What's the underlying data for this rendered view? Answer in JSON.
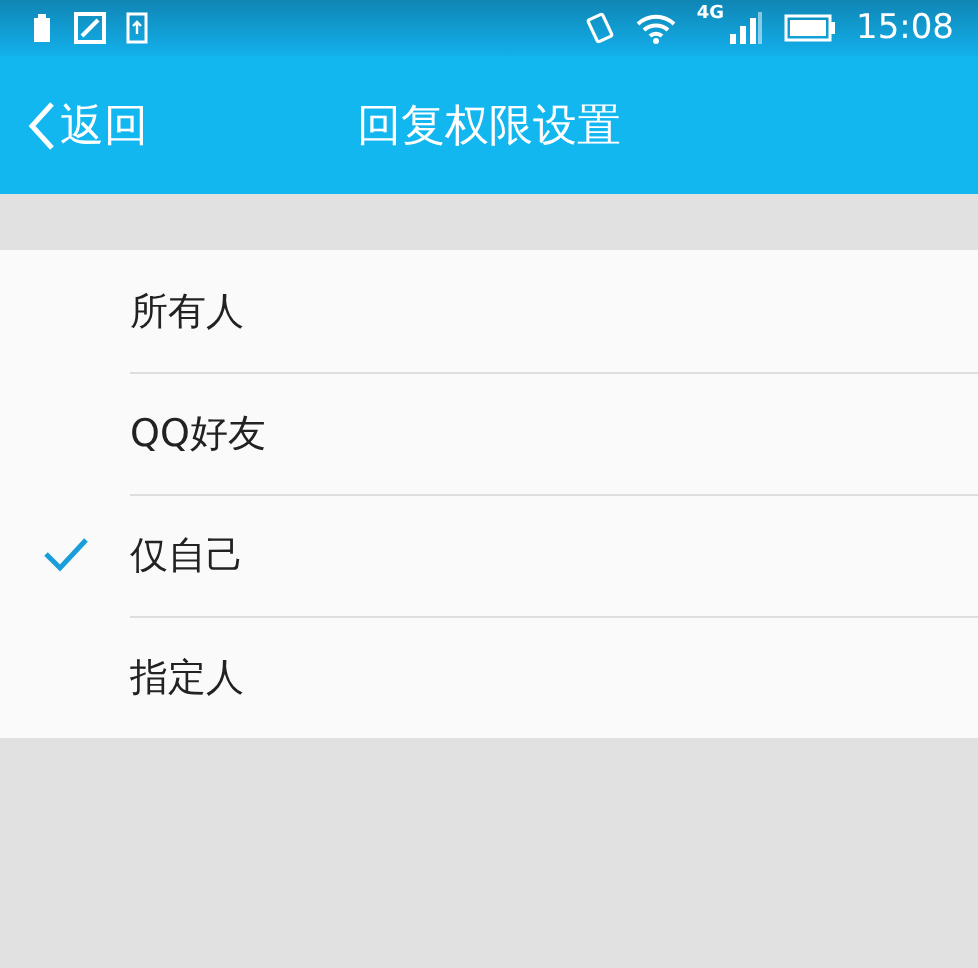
{
  "status_bar": {
    "time": "15:08",
    "network": "4G"
  },
  "header": {
    "back": "返回",
    "title": "回复权限设置"
  },
  "options": [
    {
      "label": "所有人",
      "selected": false
    },
    {
      "label": "QQ好友",
      "selected": false
    },
    {
      "label": "仅自己",
      "selected": true
    },
    {
      "label": "指定人",
      "selected": false
    }
  ]
}
